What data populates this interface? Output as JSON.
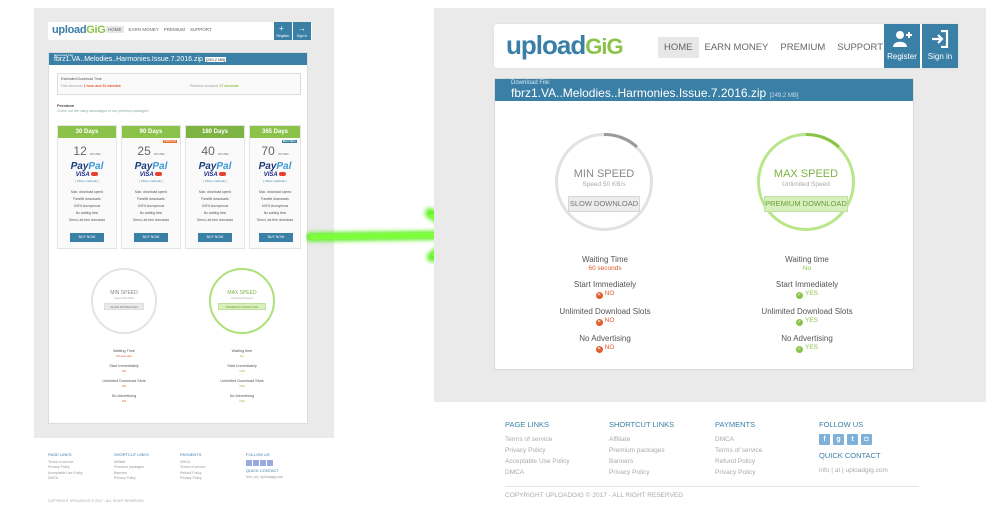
{
  "brand": {
    "logo_main": "upload",
    "logo_accent": "GiG",
    "primary_color": "#3a7fa6",
    "accent_color": "#8bc34a"
  },
  "nav": {
    "items": [
      {
        "label": "HOME",
        "active": true
      },
      {
        "label": "EARN MONEY",
        "active": false
      },
      {
        "label": "PREMIUM",
        "active": false
      },
      {
        "label": "SUPPORT",
        "active": false
      }
    ],
    "register_label": "Register",
    "signin_label": "Sign in"
  },
  "file": {
    "label": "Download File:",
    "name": "fbrz1.VA..Melodies..Harmonies.Issue.7.2016.zip",
    "size": "[249.2 MB]"
  },
  "estimated": {
    "title": "Estimated Download Time",
    "free_label": "Free Account:",
    "free_value": "1 hour and 31 minutes",
    "premium_label": "Premium Account:",
    "premium_value": "27 seconds"
  },
  "premium": {
    "title": "Premium",
    "subtitle": "Check out the many advantages of our premium packages!",
    "plans": [
      {
        "days": "30 Days",
        "price": "12",
        "unit": "00 USD",
        "tag": "",
        "buy": "BUY NOW"
      },
      {
        "days": "90 Days",
        "price": "25",
        "unit": "00 USD",
        "tag": "POPULAR",
        "buy": "BUY NOW"
      },
      {
        "days": "180 Days",
        "price": "40",
        "unit": "00 USD",
        "tag": "",
        "buy": "BUY NOW"
      },
      {
        "days": "365 Days",
        "price": "70",
        "unit": "00 USD",
        "tag": "BEST SELL",
        "buy": "BUY NOW"
      }
    ],
    "paypal_a": "Pay",
    "paypal_b": "Pal",
    "visa": "VISA",
    "other_methods": "[ Other methods ]",
    "features": [
      "Max. download speed",
      "Parallel downloads",
      "100% Anonymous",
      "No waiting time",
      "Direct, ad-free download"
    ]
  },
  "min": {
    "heading": "MIN SPEED",
    "sub": "Speed 50 KB/s",
    "button": "SLOW DOWNLOAD",
    "stats": [
      {
        "label": "Waiting Time",
        "value": "60 seconds",
        "kind": "text"
      },
      {
        "label": "Start Immediately",
        "value": "NO",
        "kind": "no"
      },
      {
        "label": "Unlimited Download Slots",
        "value": "NO",
        "kind": "no"
      },
      {
        "label": "No Advertising",
        "value": "NO",
        "kind": "no"
      }
    ]
  },
  "max": {
    "heading": "MAX SPEED",
    "sub": "Unlimited Speed",
    "button": "PREMIUM DOWNLOAD",
    "stats": [
      {
        "label": "Waiting time",
        "value": "No",
        "kind": "text"
      },
      {
        "label": "Start Immediately",
        "value": "YES",
        "kind": "yes"
      },
      {
        "label": "Unlimited Download Slots",
        "value": "YES",
        "kind": "yes"
      },
      {
        "label": "No Advertising",
        "value": "YES",
        "kind": "yes"
      }
    ]
  },
  "footer": {
    "page_links": {
      "title": "PAGE LINKS",
      "items": [
        "Terms of service",
        "Privacy Policy",
        "Acceptable Use Policy",
        "DMCA"
      ]
    },
    "shortcut_links": {
      "title": "SHORTCUT LINKS",
      "items": [
        "Affiliate",
        "Premium packages",
        "Banners",
        "Privacy Policy"
      ]
    },
    "payments": {
      "title": "PAYMENTS",
      "items": [
        "DMCA",
        "Terms of service",
        "Refund Policy",
        "Privacy Policy"
      ]
    },
    "follow": {
      "title": "FOLLOW US",
      "icons": [
        "facebook-icon",
        "google-plus-icon",
        "twitter-icon",
        "instagram-icon"
      ]
    },
    "contact": {
      "title": "QUICK CONTACT",
      "value": "info | at | uploadgig.com"
    },
    "copyright": "COPYRIGHT UPLOADGIG © 2017 - ALL RIGHT RESERVED"
  },
  "arrow_color": "#5df023"
}
